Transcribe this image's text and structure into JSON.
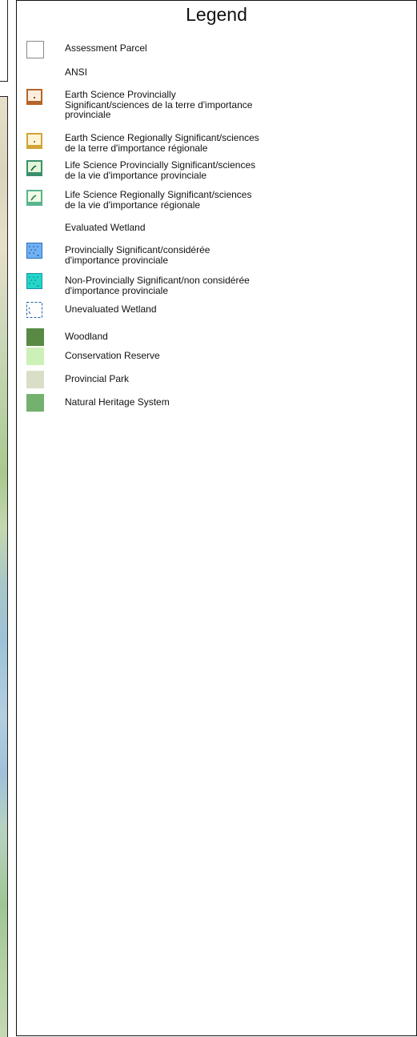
{
  "legend": {
    "title": "Legend",
    "items": [
      {
        "label": "Assessment Parcel",
        "icon": "assessment-parcel-icon",
        "color": "#888888"
      },
      {
        "section": "ANSI"
      },
      {
        "label": "Earth Science Provincially",
        "label2": "Significant/sciences de la terre d'importance",
        "label3": "provinciale",
        "icon": "earth-science-provincial-icon",
        "color": "#b5652a"
      },
      {
        "label": "Earth Science Regionally Significant/sciences",
        "label2": "de la terre d'importance régionale",
        "icon": "earth-science-regional-icon",
        "color": "#d1a437"
      },
      {
        "label": "Life Science Provincially Significant/sciences",
        "label2": "de la vie d'importance provinciale",
        "icon": "life-science-provincial-icon",
        "color": "#3a8f6a"
      },
      {
        "label": "Life Science Regionally Significant/sciences",
        "label2": "de la vie d'importance régionale",
        "icon": "life-science-regional-icon",
        "color": "#58b38f"
      },
      {
        "section": "Evaluated Wetland"
      },
      {
        "label": "Provincially Significant/considérée",
        "label2": "d'importance provinciale",
        "icon": "wetland-provincial-icon",
        "color": "#5aa0e6"
      },
      {
        "label": "Non-Provincially Significant/non considérée",
        "label2": "d'importance provinciale",
        "icon": "wetland-non-provincial-icon",
        "color": "#1fd0c0"
      },
      {
        "label": "Unevaluated Wetland",
        "icon": "unevaluated-wetland-icon",
        "color": "#1a5fa8"
      },
      {
        "label": "Woodland",
        "icon": "woodland-icon",
        "color": "#588a44"
      },
      {
        "label": "Conservation Reserve",
        "icon": "conservation-reserve-icon",
        "color": "#cdf0b8"
      },
      {
        "label": "Provincial Park",
        "icon": "provincial-park-icon",
        "color": "#d8dfc6"
      },
      {
        "label": "Natural Heritage System",
        "icon": "natural-heritage-system-icon",
        "color": "#74b06e"
      }
    ]
  }
}
